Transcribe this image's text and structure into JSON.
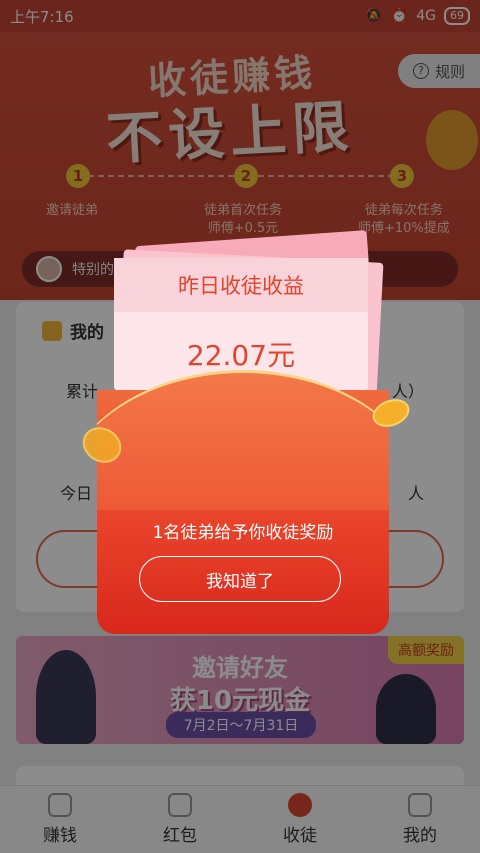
{
  "status": {
    "time": "上午7:16",
    "network": "4G",
    "battery": "69"
  },
  "header": {
    "title_small": "收徒赚钱",
    "title_big": "不设上限",
    "rules_label": "规则"
  },
  "steps": [
    {
      "num": "1",
      "line1": "邀请徒弟",
      "line2": ""
    },
    {
      "num": "2",
      "line1": "徒弟首次任务",
      "line2": "师傅+0.5元"
    },
    {
      "num": "3",
      "line1": "徒弟每次任务",
      "line2": "师傅+10%提成"
    }
  ],
  "special_bar": {
    "text": "特别的"
  },
  "card": {
    "title": "我的",
    "line1_left": "累计",
    "line1_right": "人）",
    "line2_left": "今日",
    "line2_right": "人"
  },
  "banner": {
    "tag": "高额奖励",
    "line1": "邀请好友",
    "line2": "获10元现金",
    "dates": "7月2日～7月31日"
  },
  "modal": {
    "title": "昨日收徒收益",
    "amount": "22.07元",
    "message": "1名徒弟给予你收徒奖励",
    "confirm_label": "我知道了"
  },
  "tabbar": [
    {
      "label": "赚钱",
      "active": false
    },
    {
      "label": "红包",
      "active": false
    },
    {
      "label": "收徒",
      "active": true
    },
    {
      "label": "我的",
      "active": false
    }
  ]
}
